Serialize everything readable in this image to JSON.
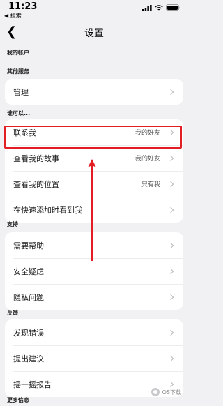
{
  "status_bar": {
    "time": "11:23",
    "back_label": "◀ 搜索"
  },
  "nav": {
    "back_icon": "chevron-left-icon",
    "title": "设置"
  },
  "sections": {
    "my_account": "我的帐户",
    "other_services": "其他服务",
    "who_can": "谁可以...",
    "support": "支持",
    "feedback": "反馈",
    "more_info": "更多信息"
  },
  "other_services": {
    "items": [
      {
        "label": "管理"
      }
    ]
  },
  "who_can": {
    "items": [
      {
        "label": "联系我",
        "value": "我的好友"
      },
      {
        "label": "查看我的故事",
        "value": "我的好友"
      },
      {
        "label": "查看我的位置",
        "value": "只有我"
      },
      {
        "label": "在快速添加时看到我",
        "value": ""
      }
    ]
  },
  "support": {
    "items": [
      {
        "label": "需要帮助"
      },
      {
        "label": "安全疑虑"
      },
      {
        "label": "隐私问题"
      }
    ]
  },
  "feedback": {
    "items": [
      {
        "label": "发现错误"
      },
      {
        "label": "提出建议"
      },
      {
        "label": "摇一摇报告"
      }
    ]
  },
  "annotation": {
    "highlight_color": "#e21d24"
  },
  "watermark": {
    "text": "OS下载"
  }
}
